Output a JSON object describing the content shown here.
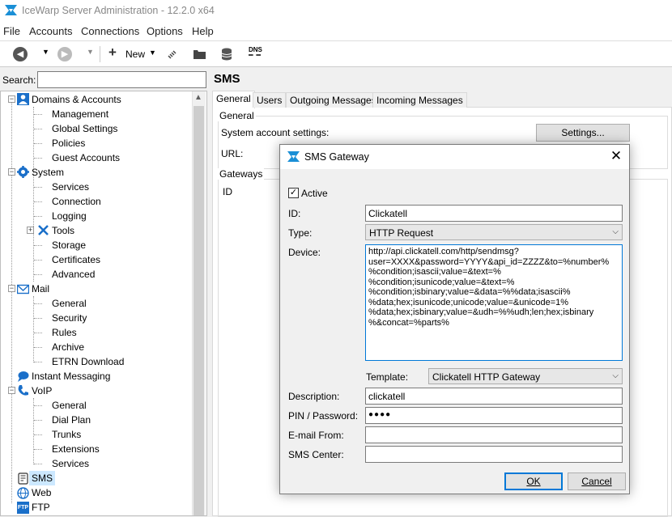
{
  "app": {
    "title": "IceWarp Server Administration - 12.2.0 x64"
  },
  "menu": [
    "File",
    "Accounts",
    "Connections",
    "Options",
    "Help"
  ],
  "toolbar": {
    "new_label": "New",
    "dns_label": "DNS"
  },
  "search": {
    "label": "Search:",
    "value": ""
  },
  "tree": {
    "domains": "Domains & Accounts",
    "domains_children": [
      "Management",
      "Global Settings",
      "Policies",
      "Guest Accounts"
    ],
    "system": "System",
    "system_children": [
      "Services",
      "Connection",
      "Logging",
      "Tools",
      "Storage",
      "Certificates",
      "Advanced"
    ],
    "mail": "Mail",
    "mail_children": [
      "General",
      "Security",
      "Rules",
      "Archive",
      "ETRN Download"
    ],
    "im": "Instant Messaging",
    "voip": "VoIP",
    "voip_children": [
      "General",
      "Dial Plan",
      "Trunks",
      "Extensions",
      "Services"
    ],
    "sms": "SMS",
    "web": "Web",
    "ftp": "FTP",
    "ftp_icon_text": "FTP"
  },
  "main": {
    "title": "SMS",
    "tabs": [
      "General",
      "Users",
      "Outgoing Messages",
      "Incoming Messages"
    ],
    "general_group": "General",
    "system_account_label": "System account settings:",
    "settings_button": "Settings...",
    "url_label": "URL:",
    "gateways_group": "Gateways",
    "id_column": "ID"
  },
  "dialog": {
    "title": "SMS Gateway",
    "active_label": "Active",
    "active_checked": true,
    "id_label": "ID:",
    "id_value": "Clickatell",
    "type_label": "Type:",
    "type_value": "HTTP Request",
    "device_label": "Device:",
    "device_value": "http://api.clickatell.com/http/sendmsg?\nuser=XXXX&password=YYYY&api_id=ZZZZ&to=%number%\n%condition;isascii;value=&text=%\n%condition;isunicode;value=&text=%\n%condition;isbinary;value=&data=%%data;isascii%\n%data;hex;isunicode;unicode;value=&unicode=1%\n%data;hex;isbinary;value=&udh=%%udh;len;hex;isbinary\n%&concat=%parts%",
    "template_label": "Template:",
    "template_value": "Clickatell HTTP Gateway",
    "description_label": "Description:",
    "description_value": "clickatell",
    "pin_label": "PIN / Password:",
    "pin_value": "●●●●",
    "email_label": "E-mail From:",
    "email_value": "",
    "smscenter_label": "SMS Center:",
    "smscenter_value": "",
    "ok_label": "OK",
    "cancel_label": "Cancel"
  },
  "colors": {
    "accent": "#0078d7",
    "icon_blue": "#1a6fc9"
  }
}
